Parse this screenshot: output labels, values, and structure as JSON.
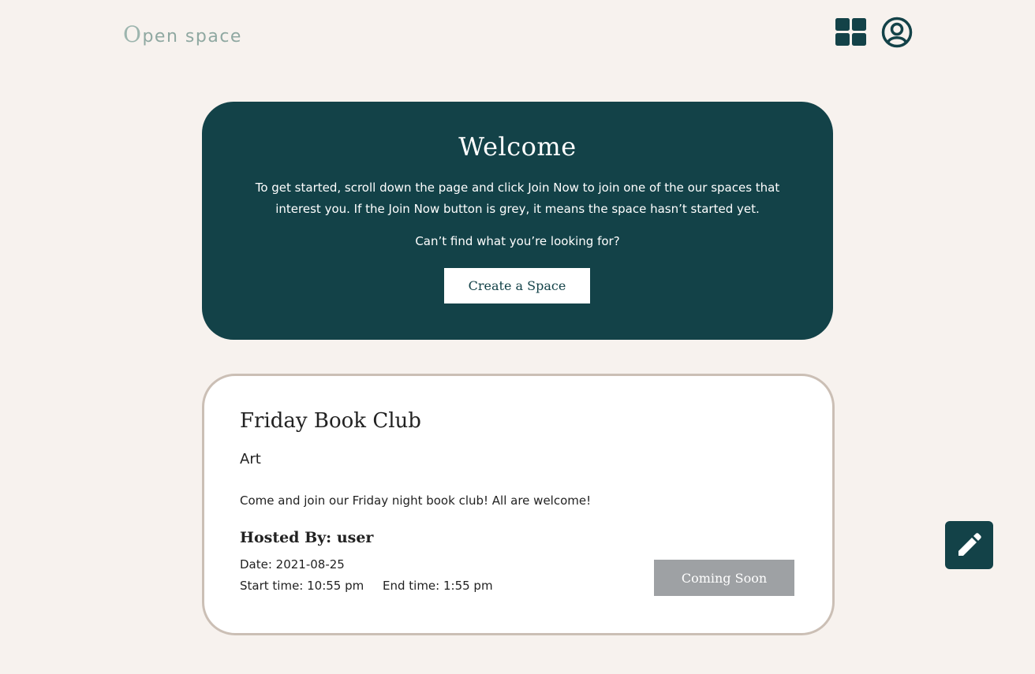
{
  "header": {
    "logo_first_letter": "O",
    "logo_rest": "pen space",
    "grid_icon": "grid-icon",
    "user_icon": "user-circle-icon"
  },
  "welcome": {
    "title": "Welcome",
    "intro": "To get started, scroll down the page and click Join Now to join one of the our spaces that interest you. If the Join Now button is grey, it means the space hasn’t started yet.",
    "question": "Can’t find what you’re looking for?",
    "create_button": "Create a Space"
  },
  "space": {
    "title": "Friday Book Club",
    "category": "Art",
    "description": "Come and join our Friday night book club! All are welcome!",
    "hosted_by": "Hosted By: user",
    "date": "Date: 2021-08-25",
    "start_time": "Start time: 10:55 pm",
    "end_time": "End time: 1:55 pm",
    "status_button": "Coming Soon"
  },
  "fab": {
    "icon": "pencil-icon"
  },
  "colors": {
    "primary": "#134248",
    "background": "#f7f2ee",
    "card_border": "#cbbfb5",
    "disabled_button": "#9ea1a4",
    "logo": "#8fa8a1"
  }
}
